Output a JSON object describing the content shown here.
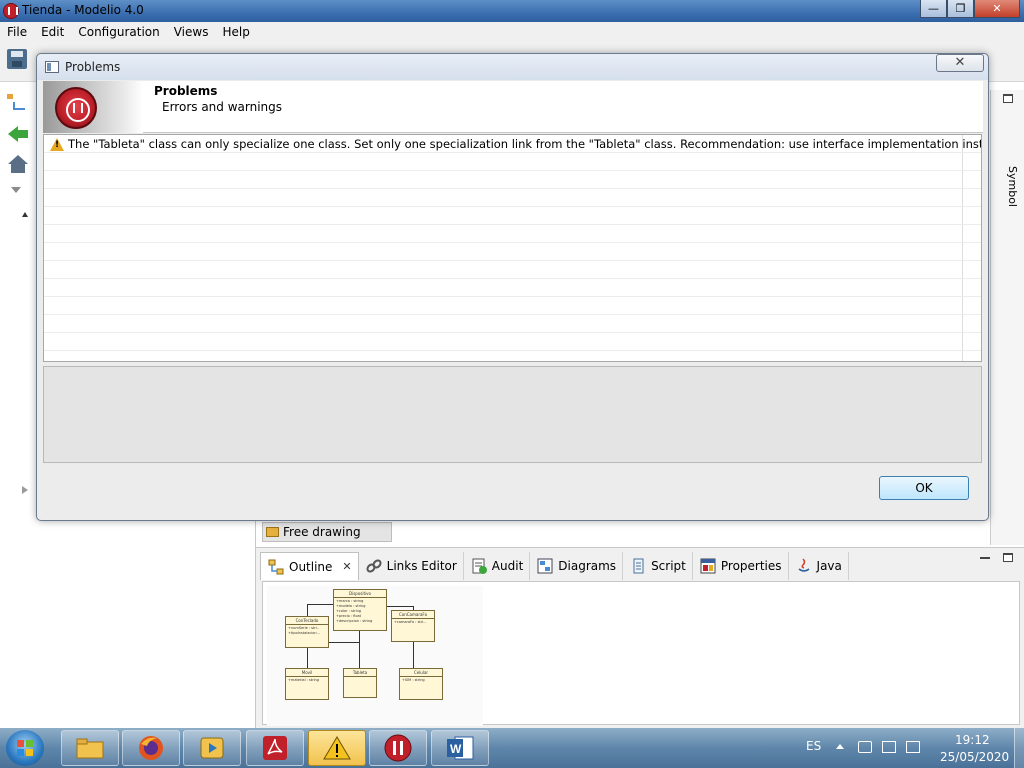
{
  "window": {
    "title": "Tienda - Modelio 4.0",
    "minimize": "—",
    "maximize": "❐",
    "close": "✕"
  },
  "menu": {
    "items": [
      "File",
      "Edit",
      "Configuration",
      "Views",
      "Help"
    ]
  },
  "side_panel": {
    "symbol_tab": "Symbol"
  },
  "editor": {
    "free_drawing_label": "Free drawing"
  },
  "bottom_tabs": [
    {
      "label": "Outline",
      "icon": "outline-icon"
    },
    {
      "label": "Links Editor",
      "icon": "link-icon"
    },
    {
      "label": "Audit",
      "icon": "audit-icon"
    },
    {
      "label": "Diagrams",
      "icon": "diagram-icon"
    },
    {
      "label": "Script",
      "icon": "script-icon"
    },
    {
      "label": "Properties",
      "icon": "properties-icon"
    },
    {
      "label": "Java",
      "icon": "java-icon"
    }
  ],
  "outline_diagram": {
    "classes": [
      {
        "name": "Dispositivo",
        "attrs": [
          "+marca : string",
          "+modelo : string",
          "+color : string",
          "+precio : float",
          "+descripcion : string"
        ]
      },
      {
        "name": "ConTeclado",
        "attrs": [
          "+numSerie : stri..",
          "+tipoInstalacion..."
        ]
      },
      {
        "name": "ConCamaraFo",
        "attrs": [
          "+camaraFo : stri..."
        ]
      },
      {
        "name": "Movil",
        "attrs": [
          "+material : string"
        ]
      },
      {
        "name": "Tableta",
        "attrs": []
      },
      {
        "name": "Celular",
        "attrs": [
          "+SIM : string"
        ]
      }
    ]
  },
  "dialog": {
    "title": "Problems",
    "close_label": "✕",
    "header_title": "Problems",
    "header_subtitle": "Errors and warnings",
    "problems": [
      {
        "severity": "warning",
        "message": "The \"Tableta\" class can only specialize one class. Set only one specialization link from the \"Tableta\" class. Recommendation: use interface implementation instead."
      }
    ],
    "ok_label": "OK"
  },
  "taskbar": {
    "language": "ES",
    "time": "19:12",
    "date": "25/05/2020",
    "apps": [
      "file-explorer-icon",
      "firefox-icon",
      "media-player-icon",
      "acrobat-icon",
      "warning-icon",
      "modelio-icon",
      "word-icon"
    ]
  },
  "colors": {
    "accent": "#3c7fb1",
    "warning": "#e5a820",
    "modelio_red": "#c0202a"
  }
}
